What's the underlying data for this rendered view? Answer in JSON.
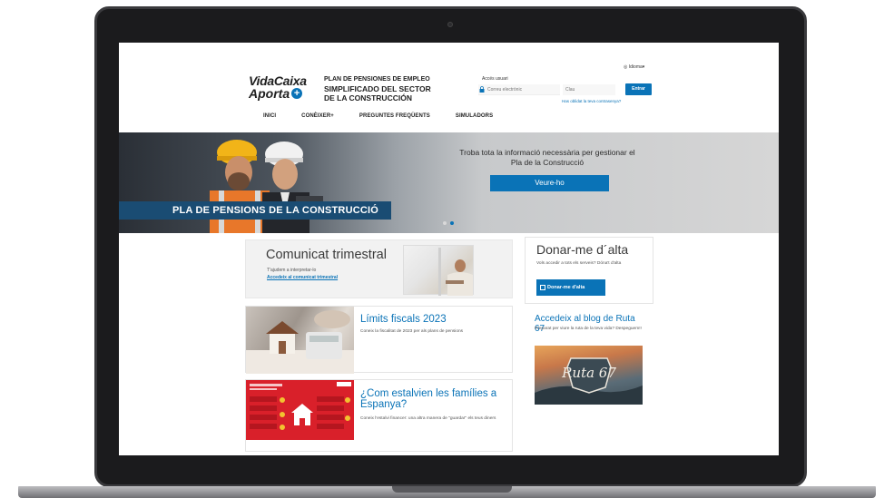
{
  "header": {
    "logo_line1": "VidaCaixa",
    "logo_line2": "Aporta",
    "logo_plus": "+",
    "plan_line1": "PLAN DE PENSIONES DE EMPLEO",
    "plan_line2": "SIMPLIFICADO DEL SECTOR",
    "plan_line3": "DE LA CONSTRUCCIÓN",
    "idioma": "Idioma",
    "access_label": "Accés usuari",
    "email_placeholder": "Correu electrònic",
    "password_placeholder": "Clau",
    "enter_label": "Entrar",
    "forgot_label": "Has oblidat la teva contrasenya?"
  },
  "nav": {
    "items": [
      {
        "label": "INICI"
      },
      {
        "label": "CONÈIXER+"
      },
      {
        "label": "PREGUNTES FREQÜENTS"
      },
      {
        "label": "SIMULADORS"
      }
    ]
  },
  "hero": {
    "band_title": "PLA DE PENSIONS DE LA CONSTRUCCIÓ",
    "text": "Troba tota la informació necessària per gestionar el Pla de la Construcció",
    "button_label": "Veure-ho",
    "slides_total": 2,
    "active_slide": 2
  },
  "cards": {
    "comunicat": {
      "title": "Comunicat trimestral",
      "subtitle": "T'ajudem a interpretar-lo",
      "link": "Accedeix al comunicat trimestral"
    },
    "donar_alta": {
      "title": "Donar-me d´alta",
      "subtitle": "Vols accedir a tots els serveis? Dóna't d'alta",
      "button_label": "Donar-me d'alta"
    },
    "limits": {
      "title": "Límits fiscals 2023",
      "subtitle": "Coneix la fiscalitat de 2023 per als plans de pensions"
    },
    "blog": {
      "title": "Accedeix al blog de Ruta 67",
      "subtitle": "Preparat per viure la ruta de la teva vida? Despeguem!!",
      "image_text": "Ruta 67"
    },
    "families": {
      "title": "¿Com estalvien les famílies a Espanya?",
      "subtitle": "Coneix l'estalvi financer: una altra manera de \"guardar\" els teus diners"
    }
  },
  "colors": {
    "brand_blue": "#0a73b7",
    "hero_band": "#1a4c73",
    "infographic_red": "#d9202a"
  }
}
